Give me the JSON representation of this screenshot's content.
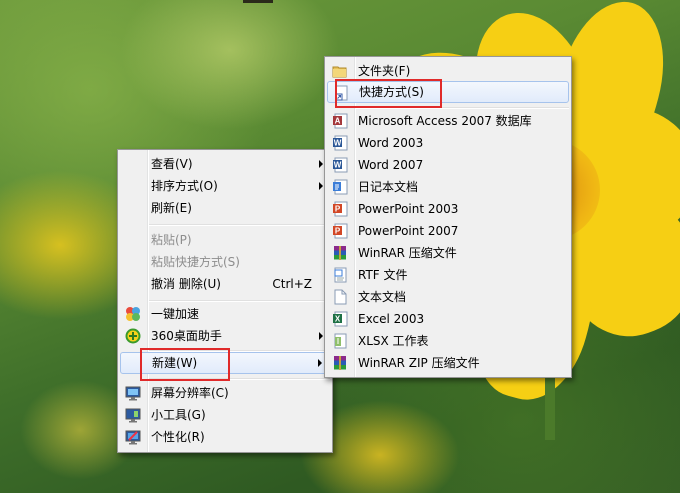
{
  "desktop_menu": {
    "items": [
      {
        "label": "查看(V)",
        "submenu": true
      },
      {
        "label": "排序方式(O)",
        "submenu": true
      },
      {
        "label": "刷新(E)"
      },
      {
        "label": "粘贴(P)",
        "disabled": true
      },
      {
        "label": "粘贴快捷方式(S)",
        "disabled": true
      },
      {
        "label": "撤消 删除(U)",
        "shortcut": "Ctrl+Z"
      },
      {
        "label": "一键加速",
        "icon": "speedup-icon"
      },
      {
        "label": "360桌面助手",
        "icon": "360-desktop-icon",
        "submenu": true
      },
      {
        "label": "新建(W)",
        "submenu": true,
        "highlighted": true
      },
      {
        "label": "屏幕分辨率(C)",
        "icon": "screen-resolution-icon"
      },
      {
        "label": "小工具(G)",
        "icon": "gadgets-icon"
      },
      {
        "label": "个性化(R)",
        "icon": "personalize-icon"
      }
    ]
  },
  "new_submenu": {
    "items": [
      {
        "label": "文件夹(F)",
        "icon": "folder-icon"
      },
      {
        "label": "快捷方式(S)",
        "icon": "shortcut-icon",
        "highlighted": true
      },
      {
        "label": "Microsoft Access 2007 数据库",
        "icon": "access-icon"
      },
      {
        "label": "Word 2003",
        "icon": "word-icon"
      },
      {
        "label": "Word 2007",
        "icon": "word-icon"
      },
      {
        "label": "日记本文档",
        "icon": "journal-icon"
      },
      {
        "label": "PowerPoint 2003",
        "icon": "powerpoint-icon"
      },
      {
        "label": "PowerPoint 2007",
        "icon": "powerpoint-icon"
      },
      {
        "label": "WinRAR 压缩文件",
        "icon": "winrar-icon"
      },
      {
        "label": "RTF 文件",
        "icon": "rtf-icon"
      },
      {
        "label": "文本文档",
        "icon": "text-document-icon"
      },
      {
        "label": "Excel 2003",
        "icon": "excel-icon"
      },
      {
        "label": "XLSX 工作表",
        "icon": "xlsx-icon"
      },
      {
        "label": "WinRAR ZIP 压缩文件",
        "icon": "winrar-zip-icon"
      }
    ]
  },
  "colors": {
    "menu_bg": "#f0f0f0",
    "highlight_border": "#a6c3ec",
    "annotation_red": "#e02a2a",
    "flower_yellow": "#f6cf14"
  }
}
